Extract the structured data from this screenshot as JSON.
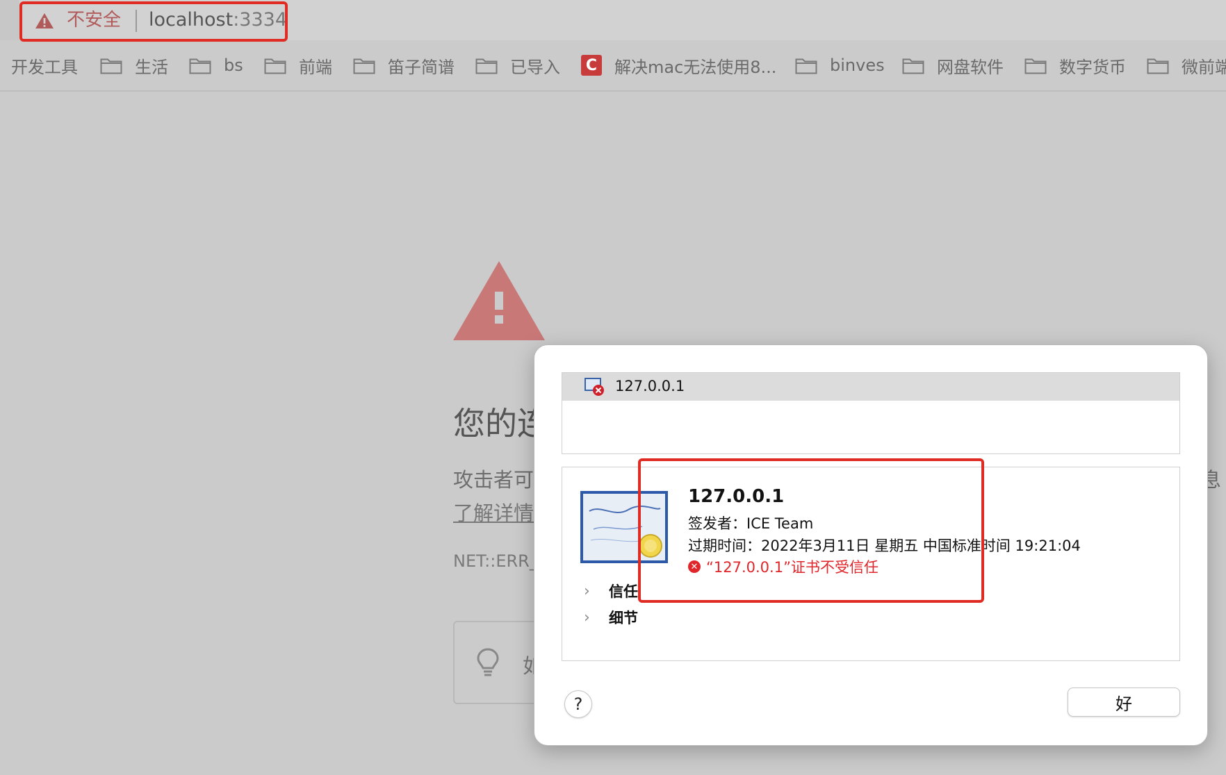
{
  "address_bar": {
    "security_label": "不安全",
    "url_host": "localhost",
    "url_port": ":3334",
    "security_color": "#b05a5a"
  },
  "bookmarks": [
    {
      "label": "开发工具",
      "icon": "none"
    },
    {
      "label": "生活",
      "icon": "folder-icon"
    },
    {
      "label": "bs",
      "icon": "folder-icon"
    },
    {
      "label": "前端",
      "icon": "folder-icon"
    },
    {
      "label": "笛子简谱",
      "icon": "folder-icon"
    },
    {
      "label": "已导入",
      "icon": "folder-icon"
    },
    {
      "label": "解决mac无法使用8...",
      "icon": "site-c-icon"
    },
    {
      "label": "binves",
      "icon": "folder-icon"
    },
    {
      "label": "网盘软件",
      "icon": "folder-icon"
    },
    {
      "label": "数字货币",
      "icon": "folder-icon"
    },
    {
      "label": "微前端",
      "icon": "folder-icon"
    }
  ],
  "error_page": {
    "title": "您的连",
    "description": "攻击者可",
    "learn_more": "了解详情",
    "right_fragment": "息",
    "error_code": "NET::ERR_",
    "tip_fragment": "如"
  },
  "dialog": {
    "cert_list_item": "127.0.0.1",
    "cert_name": "127.0.0.1",
    "issuer": "签发者：ICE Team",
    "expiry": "过期时间：2022年3月11日 星期五 中国标准时间 19:21:04",
    "warning": "“127.0.0.1”证书不受信任",
    "trust_label": "信任",
    "details_label": "细节",
    "help_label": "?",
    "ok_label": "好",
    "warning_color": "#e0262a"
  },
  "highlight_color": "#e02b22"
}
